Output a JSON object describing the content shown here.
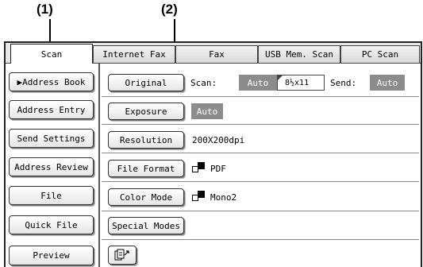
{
  "callouts": {
    "one": "(1)",
    "two": "(2)"
  },
  "tabs": [
    {
      "label": "Scan",
      "active": true
    },
    {
      "label": "Internet Fax",
      "active": false
    },
    {
      "label": "Fax",
      "active": false
    },
    {
      "label": "USB Mem. Scan",
      "active": false
    },
    {
      "label": "PC Scan",
      "active": false
    }
  ],
  "left_menu": {
    "address_book": "▶Address Book",
    "address_entry": "Address Entry",
    "send_settings": "Send Settings",
    "address_review": "Address Review",
    "file": "File",
    "quick_file": "Quick File",
    "preview": "Preview"
  },
  "main": {
    "original": {
      "button": "Original",
      "scan_label": "Scan:",
      "scan_value": "Auto",
      "paper_size": "8½x11",
      "send_label": "Send:",
      "send_value": "Auto"
    },
    "exposure": {
      "button": "Exposure",
      "value": "Auto"
    },
    "resolution": {
      "button": "Resolution",
      "value": "200X200dpi"
    },
    "file_format": {
      "button": "File Format",
      "value": "PDF",
      "icon": "color-mode-icon"
    },
    "color_mode": {
      "button": "Color Mode",
      "value": "Mono2",
      "icon": "color-mode-icon"
    },
    "special_modes": {
      "button": "Special Modes"
    },
    "extra_icon": "document-export-icon"
  },
  "colors": {
    "badge": "#8c8c8c",
    "panel_bg": "#ffffff",
    "frame_bg": "#e8e8e8"
  }
}
